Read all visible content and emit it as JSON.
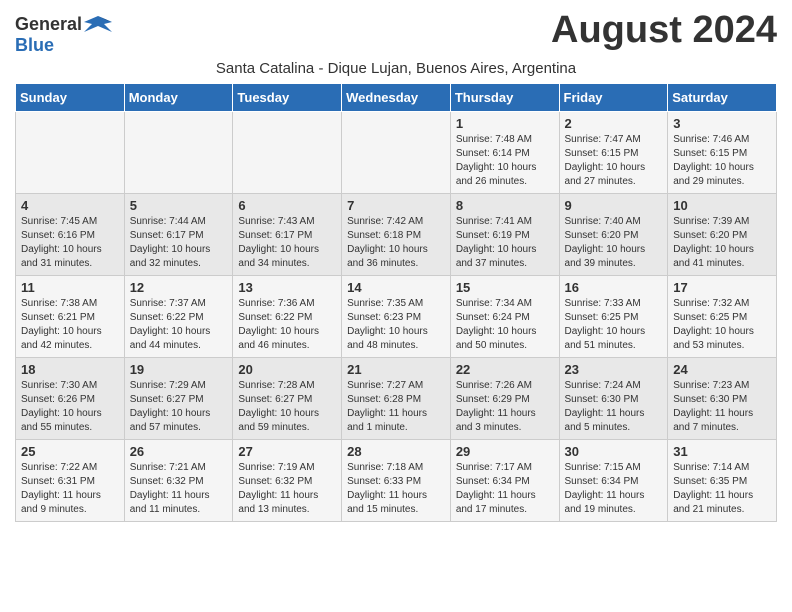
{
  "header": {
    "logo_general": "General",
    "logo_blue": "Blue",
    "month_title": "August 2024",
    "subtitle": "Santa Catalina - Dique Lujan, Buenos Aires, Argentina"
  },
  "days_of_week": [
    "Sunday",
    "Monday",
    "Tuesday",
    "Wednesday",
    "Thursday",
    "Friday",
    "Saturday"
  ],
  "weeks": [
    [
      {
        "day": "",
        "info": ""
      },
      {
        "day": "",
        "info": ""
      },
      {
        "day": "",
        "info": ""
      },
      {
        "day": "",
        "info": ""
      },
      {
        "day": "1",
        "info": "Sunrise: 7:48 AM\nSunset: 6:14 PM\nDaylight: 10 hours\nand 26 minutes."
      },
      {
        "day": "2",
        "info": "Sunrise: 7:47 AM\nSunset: 6:15 PM\nDaylight: 10 hours\nand 27 minutes."
      },
      {
        "day": "3",
        "info": "Sunrise: 7:46 AM\nSunset: 6:15 PM\nDaylight: 10 hours\nand 29 minutes."
      }
    ],
    [
      {
        "day": "4",
        "info": "Sunrise: 7:45 AM\nSunset: 6:16 PM\nDaylight: 10 hours\nand 31 minutes."
      },
      {
        "day": "5",
        "info": "Sunrise: 7:44 AM\nSunset: 6:17 PM\nDaylight: 10 hours\nand 32 minutes."
      },
      {
        "day": "6",
        "info": "Sunrise: 7:43 AM\nSunset: 6:17 PM\nDaylight: 10 hours\nand 34 minutes."
      },
      {
        "day": "7",
        "info": "Sunrise: 7:42 AM\nSunset: 6:18 PM\nDaylight: 10 hours\nand 36 minutes."
      },
      {
        "day": "8",
        "info": "Sunrise: 7:41 AM\nSunset: 6:19 PM\nDaylight: 10 hours\nand 37 minutes."
      },
      {
        "day": "9",
        "info": "Sunrise: 7:40 AM\nSunset: 6:20 PM\nDaylight: 10 hours\nand 39 minutes."
      },
      {
        "day": "10",
        "info": "Sunrise: 7:39 AM\nSunset: 6:20 PM\nDaylight: 10 hours\nand 41 minutes."
      }
    ],
    [
      {
        "day": "11",
        "info": "Sunrise: 7:38 AM\nSunset: 6:21 PM\nDaylight: 10 hours\nand 42 minutes."
      },
      {
        "day": "12",
        "info": "Sunrise: 7:37 AM\nSunset: 6:22 PM\nDaylight: 10 hours\nand 44 minutes."
      },
      {
        "day": "13",
        "info": "Sunrise: 7:36 AM\nSunset: 6:22 PM\nDaylight: 10 hours\nand 46 minutes."
      },
      {
        "day": "14",
        "info": "Sunrise: 7:35 AM\nSunset: 6:23 PM\nDaylight: 10 hours\nand 48 minutes."
      },
      {
        "day": "15",
        "info": "Sunrise: 7:34 AM\nSunset: 6:24 PM\nDaylight: 10 hours\nand 50 minutes."
      },
      {
        "day": "16",
        "info": "Sunrise: 7:33 AM\nSunset: 6:25 PM\nDaylight: 10 hours\nand 51 minutes."
      },
      {
        "day": "17",
        "info": "Sunrise: 7:32 AM\nSunset: 6:25 PM\nDaylight: 10 hours\nand 53 minutes."
      }
    ],
    [
      {
        "day": "18",
        "info": "Sunrise: 7:30 AM\nSunset: 6:26 PM\nDaylight: 10 hours\nand 55 minutes."
      },
      {
        "day": "19",
        "info": "Sunrise: 7:29 AM\nSunset: 6:27 PM\nDaylight: 10 hours\nand 57 minutes."
      },
      {
        "day": "20",
        "info": "Sunrise: 7:28 AM\nSunset: 6:27 PM\nDaylight: 10 hours\nand 59 minutes."
      },
      {
        "day": "21",
        "info": "Sunrise: 7:27 AM\nSunset: 6:28 PM\nDaylight: 11 hours\nand 1 minute."
      },
      {
        "day": "22",
        "info": "Sunrise: 7:26 AM\nSunset: 6:29 PM\nDaylight: 11 hours\nand 3 minutes."
      },
      {
        "day": "23",
        "info": "Sunrise: 7:24 AM\nSunset: 6:30 PM\nDaylight: 11 hours\nand 5 minutes."
      },
      {
        "day": "24",
        "info": "Sunrise: 7:23 AM\nSunset: 6:30 PM\nDaylight: 11 hours\nand 7 minutes."
      }
    ],
    [
      {
        "day": "25",
        "info": "Sunrise: 7:22 AM\nSunset: 6:31 PM\nDaylight: 11 hours\nand 9 minutes."
      },
      {
        "day": "26",
        "info": "Sunrise: 7:21 AM\nSunset: 6:32 PM\nDaylight: 11 hours\nand 11 minutes."
      },
      {
        "day": "27",
        "info": "Sunrise: 7:19 AM\nSunset: 6:32 PM\nDaylight: 11 hours\nand 13 minutes."
      },
      {
        "day": "28",
        "info": "Sunrise: 7:18 AM\nSunset: 6:33 PM\nDaylight: 11 hours\nand 15 minutes."
      },
      {
        "day": "29",
        "info": "Sunrise: 7:17 AM\nSunset: 6:34 PM\nDaylight: 11 hours\nand 17 minutes."
      },
      {
        "day": "30",
        "info": "Sunrise: 7:15 AM\nSunset: 6:34 PM\nDaylight: 11 hours\nand 19 minutes."
      },
      {
        "day": "31",
        "info": "Sunrise: 7:14 AM\nSunset: 6:35 PM\nDaylight: 11 hours\nand 21 minutes."
      }
    ]
  ]
}
